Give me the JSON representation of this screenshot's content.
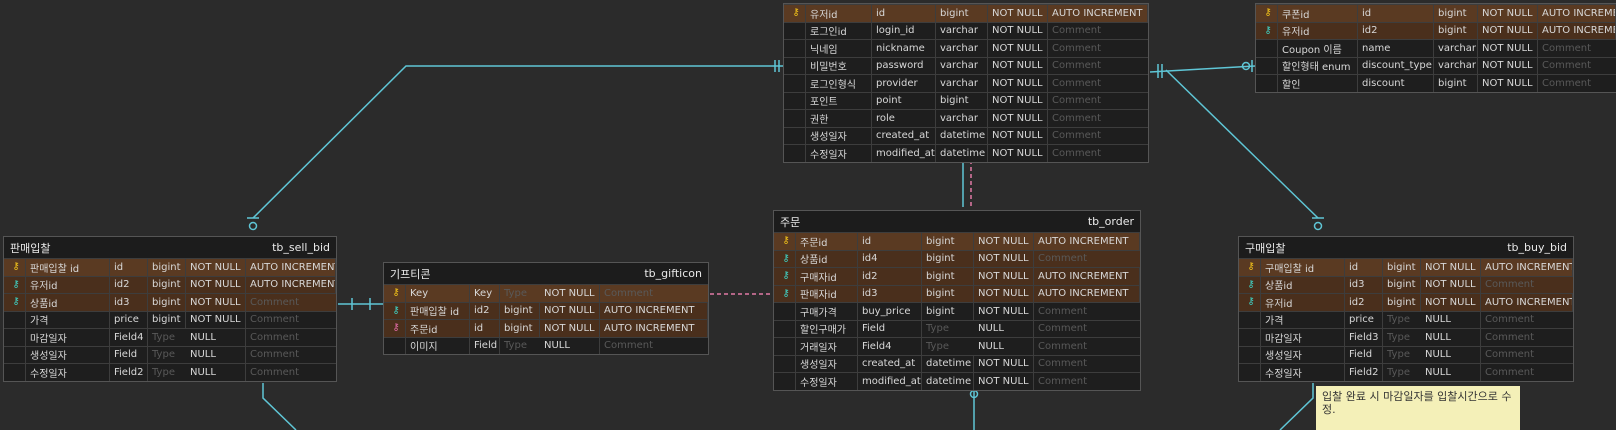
{
  "tables": [
    {
      "id": "user",
      "title": "",
      "name": "",
      "rows": [
        [
          "pk",
          "유저id",
          "id",
          "bigint",
          "NOT NULL",
          "AUTO INCREMENT"
        ],
        [
          "",
          "로그인id",
          "login_id",
          "varchar",
          "NOT NULL",
          "Comment"
        ],
        [
          "",
          "닉네임",
          "nickname",
          "varchar",
          "NOT NULL",
          "Comment"
        ],
        [
          "",
          "비밀번호",
          "password",
          "varchar",
          "NOT NULL",
          "Comment"
        ],
        [
          "",
          "로그인형식",
          "provider",
          "varchar",
          "NOT NULL",
          "Comment"
        ],
        [
          "",
          "포인트",
          "point",
          "bigint",
          "NOT NULL",
          "Comment"
        ],
        [
          "",
          "권한",
          "role",
          "varchar",
          "NOT NULL",
          "Comment"
        ],
        [
          "",
          "생성일자",
          "created_at",
          "datetime",
          "NOT NULL",
          "Comment"
        ],
        [
          "",
          "수정일자",
          "modified_at",
          "datetime",
          "NOT NULL",
          "Comment"
        ]
      ]
    },
    {
      "id": "coupon",
      "title": "",
      "name": "",
      "rows": [
        [
          "pk",
          "쿠폰id",
          "id",
          "bigint",
          "NOT NULL",
          "AUTO INCREMENT"
        ],
        [
          "fk",
          "유저id",
          "id2",
          "bigint",
          "NOT NULL",
          "AUTO INCREMENT"
        ],
        [
          "",
          "Coupon 이름",
          "name",
          "varchar",
          "NOT NULL",
          "Comment"
        ],
        [
          "",
          "할인형태 enum",
          "discount_type",
          "varchar",
          "NOT NULL",
          "Comment"
        ],
        [
          "",
          "할인",
          "discount",
          "bigint",
          "NOT NULL",
          "Comment"
        ]
      ]
    },
    {
      "id": "sell_bid",
      "title": "판매입찰",
      "name": "tb_sell_bid",
      "rows": [
        [
          "pk",
          "판매입찰 id",
          "id",
          "bigint",
          "NOT NULL",
          "AUTO INCREMENT"
        ],
        [
          "fk",
          "유저id",
          "id2",
          "bigint",
          "NOT NULL",
          "AUTO INCREMENT"
        ],
        [
          "fk",
          "상품id",
          "id3",
          "bigint",
          "NOT NULL",
          "Comment"
        ],
        [
          "",
          "가격",
          "price",
          "bigint",
          "NOT NULL",
          "Comment"
        ],
        [
          "",
          "마감일자",
          "Field4",
          "Type",
          "NULL",
          "Comment"
        ],
        [
          "",
          "생성일자",
          "Field",
          "Type",
          "NULL",
          "Comment"
        ],
        [
          "",
          "수정일자",
          "Field2",
          "Type",
          "NULL",
          "Comment"
        ]
      ]
    },
    {
      "id": "gifticon",
      "title": "기프티콘",
      "name": "tb_gifticon",
      "rows": [
        [
          "pk",
          "Key",
          "Key",
          "Type",
          "NOT NULL",
          "Comment"
        ],
        [
          "fk",
          "판매입찰 id",
          "id2",
          "bigint",
          "NOT NULL",
          "AUTO INCREMENT"
        ],
        [
          "pf",
          "주문id",
          "id",
          "bigint",
          "NOT NULL",
          "AUTO INCREMENT"
        ],
        [
          "",
          "이미지",
          "Field",
          "Type",
          "NULL",
          "Comment"
        ]
      ]
    },
    {
      "id": "order",
      "title": "주문",
      "name": "tb_order",
      "rows": [
        [
          "pk",
          "주문id",
          "id",
          "bigint",
          "NOT NULL",
          "AUTO INCREMENT"
        ],
        [
          "fk",
          "상품id",
          "id4",
          "bigint",
          "NOT NULL",
          "Comment"
        ],
        [
          "fk",
          "구매자id",
          "id2",
          "bigint",
          "NOT NULL",
          "AUTO INCREMENT"
        ],
        [
          "fk",
          "판매자id",
          "id3",
          "bigint",
          "NOT NULL",
          "AUTO INCREMENT"
        ],
        [
          "",
          "구매가격",
          "buy_price",
          "bigint",
          "NOT NULL",
          "Comment"
        ],
        [
          "",
          "할인구매가",
          "Field",
          "Type",
          "NULL",
          "Comment"
        ],
        [
          "",
          "거래일자",
          "Field4",
          "Type",
          "NULL",
          "Comment"
        ],
        [
          "",
          "생성일자",
          "created_at",
          "datetime",
          "NOT NULL",
          "Comment"
        ],
        [
          "",
          "수정일자",
          "modified_at",
          "datetime",
          "NOT NULL",
          "Comment"
        ]
      ]
    },
    {
      "id": "buy_bid",
      "title": "구매입찰",
      "name": "tb_buy_bid",
      "rows": [
        [
          "pk",
          "구매입찰 id",
          "id",
          "bigint",
          "NOT NULL",
          "AUTO INCREMENT"
        ],
        [
          "fk",
          "상품id",
          "id3",
          "bigint",
          "NOT NULL",
          "Comment"
        ],
        [
          "fk",
          "유저id",
          "id2",
          "bigint",
          "NOT NULL",
          "AUTO INCREMENT"
        ],
        [
          "",
          "가격",
          "price",
          "Type",
          "NULL",
          "Comment"
        ],
        [
          "",
          "마감일자",
          "Field3",
          "Type",
          "NULL",
          "Comment"
        ],
        [
          "",
          "생성일자",
          "Field",
          "Type",
          "NULL",
          "Comment"
        ],
        [
          "",
          "수정일자",
          "Field2",
          "Type",
          "NULL",
          "Comment"
        ]
      ]
    }
  ],
  "note": {
    "text": "입찰 완료 시 마감일자를 입찰시간으로 수정."
  },
  "colors": {
    "background": "#2b2b2b",
    "connector": "#5fc6d6",
    "connector_dashed": "#e27aa6",
    "pk_row": "#5a3a22",
    "fk_row": "#4a2f1c",
    "pk_key": "#f2c31a",
    "fk_key": "#3fd1c4",
    "note_bg": "#f4f0b8"
  },
  "icons": {
    "pk": "key-icon-gold",
    "fk": "key-icon-teal",
    "pf": "key-icon-pink"
  }
}
